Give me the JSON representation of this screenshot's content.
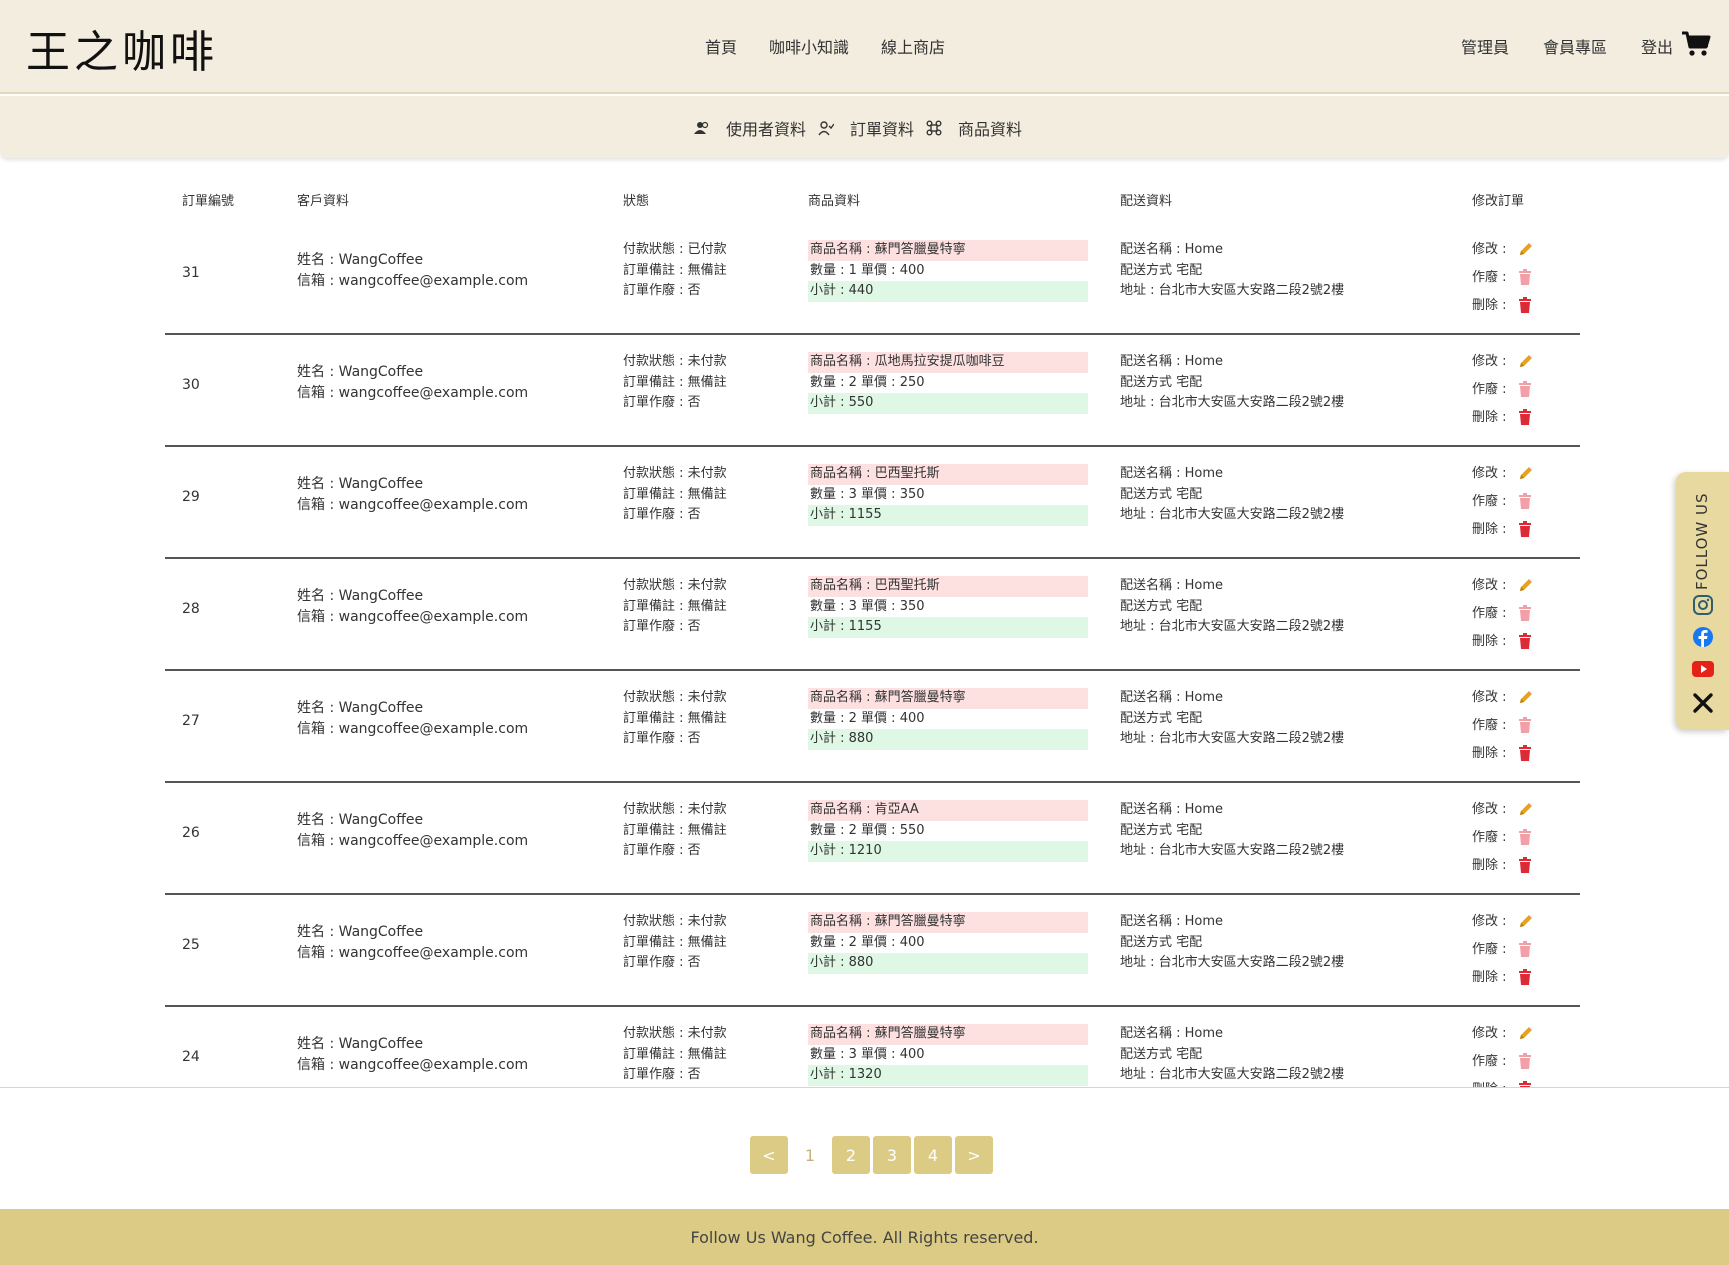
{
  "header": {
    "logo": "王之咖啡",
    "nav": [
      "首頁",
      "咖啡小知識",
      "線上商店"
    ],
    "right_nav": [
      "管理員",
      "會員專區",
      "登出"
    ],
    "cart_icon": "shopping-cart-icon"
  },
  "subnav": {
    "items": [
      {
        "icon": "users-icon",
        "label": "使用者資料"
      },
      {
        "icon": "user-check-icon",
        "label": "訂單資料"
      },
      {
        "icon": "command-icon",
        "label": "商品資料"
      }
    ]
  },
  "table": {
    "headers": {
      "id": "訂單編號",
      "customer": "客戶資料",
      "status": "狀態",
      "product": "商品資料",
      "shipping": "配送資料",
      "edit": "修改訂單"
    },
    "rows": [
      {
        "id": "31",
        "name": "姓名 : WangCoffee",
        "email": "信箱 : wangcoffee@example.com",
        "pay": "付款狀態 : 已付款",
        "note": "訂單備註 : 無備註",
        "void": "訂單作廢 : 否",
        "product": "商品名稱 : 蘇門答臘曼特寧",
        "qty": "數量 : 1  單價 : 400",
        "subtotal": "小計 : 440",
        "ship_name": "配送名稱 : Home",
        "ship_method": "配送方式 宅配",
        "address": "地址 : 台北市大安區大安路二段2號2樓"
      },
      {
        "id": "30",
        "name": "姓名 : WangCoffee",
        "email": "信箱 : wangcoffee@example.com",
        "pay": "付款狀態 : 未付款",
        "note": "訂單備註 : 無備註",
        "void": "訂單作廢 : 否",
        "product": "商品名稱 : 瓜地馬拉安提瓜咖啡豆",
        "qty": "數量 : 2  單價 : 250",
        "subtotal": "小計 : 550",
        "ship_name": "配送名稱 : Home",
        "ship_method": "配送方式 宅配",
        "address": "地址 : 台北市大安區大安路二段2號2樓"
      },
      {
        "id": "29",
        "name": "姓名 : WangCoffee",
        "email": "信箱 : wangcoffee@example.com",
        "pay": "付款狀態 : 未付款",
        "note": "訂單備註 : 無備註",
        "void": "訂單作廢 : 否",
        "product": "商品名稱 : 巴西聖托斯",
        "qty": "數量 : 3  單價 : 350",
        "subtotal": "小計 : 1155",
        "ship_name": "配送名稱 : Home",
        "ship_method": "配送方式 宅配",
        "address": "地址 : 台北市大安區大安路二段2號2樓"
      },
      {
        "id": "28",
        "name": "姓名 : WangCoffee",
        "email": "信箱 : wangcoffee@example.com",
        "pay": "付款狀態 : 未付款",
        "note": "訂單備註 : 無備註",
        "void": "訂單作廢 : 否",
        "product": "商品名稱 : 巴西聖托斯",
        "qty": "數量 : 3  單價 : 350",
        "subtotal": "小計 : 1155",
        "ship_name": "配送名稱 : Home",
        "ship_method": "配送方式 宅配",
        "address": "地址 : 台北市大安區大安路二段2號2樓"
      },
      {
        "id": "27",
        "name": "姓名 : WangCoffee",
        "email": "信箱 : wangcoffee@example.com",
        "pay": "付款狀態 : 未付款",
        "note": "訂單備註 : 無備註",
        "void": "訂單作廢 : 否",
        "product": "商品名稱 : 蘇門答臘曼特寧",
        "qty": "數量 : 2  單價 : 400",
        "subtotal": "小計 : 880",
        "ship_name": "配送名稱 : Home",
        "ship_method": "配送方式 宅配",
        "address": "地址 : 台北市大安區大安路二段2號2樓"
      },
      {
        "id": "26",
        "name": "姓名 : WangCoffee",
        "email": "信箱 : wangcoffee@example.com",
        "pay": "付款狀態 : 未付款",
        "note": "訂單備註 : 無備註",
        "void": "訂單作廢 : 否",
        "product": "商品名稱 : 肯亞AA",
        "qty": "數量 : 2  單價 : 550",
        "subtotal": "小計 : 1210",
        "ship_name": "配送名稱 : Home",
        "ship_method": "配送方式 宅配",
        "address": "地址 : 台北市大安區大安路二段2號2樓"
      },
      {
        "id": "25",
        "name": "姓名 : WangCoffee",
        "email": "信箱 : wangcoffee@example.com",
        "pay": "付款狀態 : 未付款",
        "note": "訂單備註 : 無備註",
        "void": "訂單作廢 : 否",
        "product": "商品名稱 : 蘇門答臘曼特寧",
        "qty": "數量 : 2  單價 : 400",
        "subtotal": "小計 : 880",
        "ship_name": "配送名稱 : Home",
        "ship_method": "配送方式 宅配",
        "address": "地址 : 台北市大安區大安路二段2號2樓"
      },
      {
        "id": "24",
        "name": "姓名 : WangCoffee",
        "email": "信箱 : wangcoffee@example.com",
        "pay": "付款狀態 : 未付款",
        "note": "訂單備註 : 無備註",
        "void": "訂單作廢 : 否",
        "product": "商品名稱 : 蘇門答臘曼特寧",
        "qty": "數量 : 3  單價 : 400",
        "subtotal": "小計 : 1320",
        "ship_name": "配送名稱 : Home",
        "ship_method": "配送方式 宅配",
        "address": "地址 : 台北市大安區大安路二段2號2樓"
      }
    ],
    "actions": {
      "edit": "修改 :",
      "void": "作廢 :",
      "delete": "刪除 :",
      "edit_icon": "pencil-icon",
      "void_icon": "trash-icon",
      "delete_icon": "trash-icon"
    }
  },
  "pagination": {
    "prev": "<",
    "pages": [
      "1",
      "2",
      "3",
      "4"
    ],
    "current": "1",
    "next": ">"
  },
  "footer": {
    "text": "Follow Us Wang Coffee. All Rights reserved."
  },
  "follow": {
    "label": "FOLLOW US",
    "icons": [
      "instagram-icon",
      "facebook-icon",
      "youtube-icon",
      "x-icon"
    ]
  },
  "colors": {
    "header_bg": "#f3ede0",
    "accent": "#dccb85",
    "product_name_bg": "#fde0e0",
    "subtotal_bg": "#dff8e6",
    "edit_icon": "#e6a220",
    "void_icon": "#f0a0a6",
    "delete_icon": "#dc2a36"
  }
}
